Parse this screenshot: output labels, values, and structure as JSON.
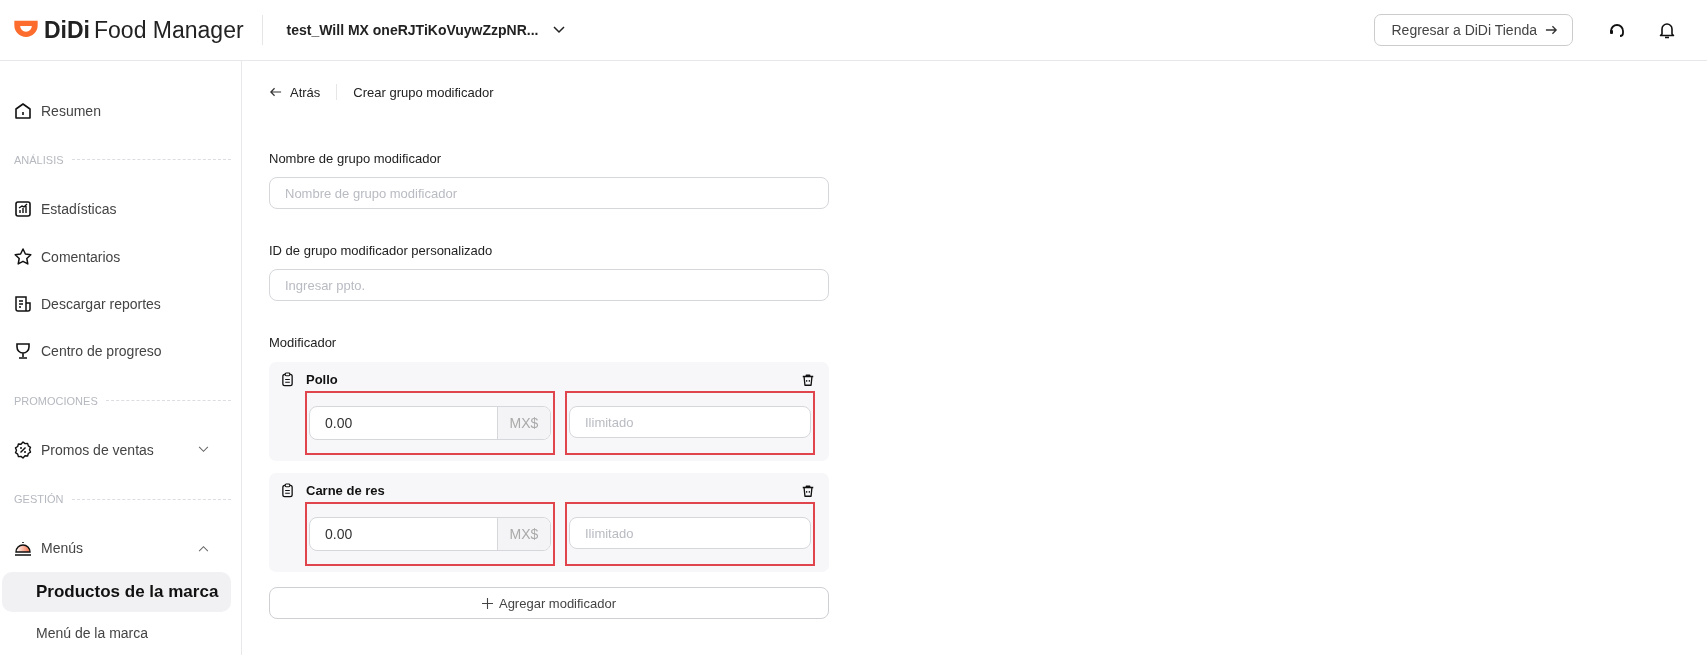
{
  "header": {
    "logo_brand": "DiDi",
    "logo_product": "Food Manager",
    "store_name": "test_Will MX oneRJTiKoVuywZzpNR...",
    "return_button": "Regresar a DiDi Tienda"
  },
  "sidebar": {
    "items": [
      {
        "kind": "item",
        "label": "Resumen",
        "selected": false
      },
      {
        "kind": "section",
        "label": "ANÁLISIS"
      },
      {
        "kind": "item",
        "label": "Estadísticas",
        "selected": false
      },
      {
        "kind": "item",
        "label": "Comentarios",
        "selected": false
      },
      {
        "kind": "item",
        "label": "Descargar reportes",
        "selected": false
      },
      {
        "kind": "item",
        "label": "Centro de progreso",
        "selected": false
      },
      {
        "kind": "section",
        "label": "PROMOCIONES"
      },
      {
        "kind": "item",
        "label": "Promos de ventas",
        "selected": false,
        "expanded": false
      },
      {
        "kind": "section",
        "label": "GESTIÓN"
      },
      {
        "kind": "item",
        "label": "Menús",
        "selected": false,
        "expanded": true,
        "children": [
          {
            "label": "Productos de la marca",
            "selected": true
          },
          {
            "label": "Menú de la marca",
            "selected": false
          }
        ]
      }
    ]
  },
  "breadcrumb": {
    "back": "Atrás",
    "title": "Crear grupo modificador"
  },
  "fields": [
    {
      "label": "Nombre de grupo modificador",
      "placeholder": "Nombre de grupo modificador"
    },
    {
      "label": "ID de grupo modificador personalizado",
      "placeholder": "Ingresar ppto."
    }
  ],
  "modifiers": {
    "label": "Modificador",
    "items": [
      {
        "name": "Pollo",
        "price": "0.00",
        "currency": "MX$",
        "limit_placeholder": "Ilimitado",
        "highlighted": true
      },
      {
        "name": "Carne de res",
        "price": "0.00",
        "currency": "MX$",
        "limit_placeholder": "Ilimitado",
        "highlighted": true
      }
    ]
  },
  "add_button": "Agregar modificador"
}
